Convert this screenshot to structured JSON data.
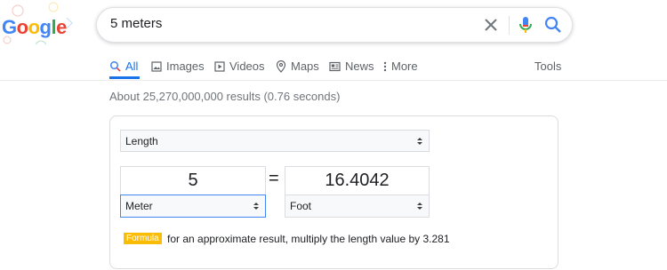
{
  "logo": {
    "letters": [
      "G",
      "o",
      "o",
      "g",
      "l",
      "e"
    ],
    "colors": [
      "#4285f4",
      "#ea4335",
      "#fbbc05",
      "#4285f4",
      "#34a853",
      "#ea4335"
    ]
  },
  "search": {
    "query": "5 meters",
    "placeholder": ""
  },
  "nav": {
    "items": [
      {
        "label": "All",
        "icon": "search-icon",
        "active": true
      },
      {
        "label": "Images",
        "icon": "image-icon"
      },
      {
        "label": "Videos",
        "icon": "video-icon"
      },
      {
        "label": "Maps",
        "icon": "map-pin-icon"
      },
      {
        "label": "News",
        "icon": "news-icon"
      },
      {
        "label": "More",
        "icon": "more-vert-icon"
      }
    ],
    "tools": "Tools"
  },
  "results_stats": "About 25,270,000,000 results (0.76 seconds)",
  "converter": {
    "category": "Length",
    "from_value": "5",
    "equals": "=",
    "to_value": "16.4042",
    "from_unit": "Meter",
    "to_unit": "Foot",
    "formula_badge": "Formula",
    "formula_text": "for an approximate result, multiply the length value by 3.281"
  },
  "colors": {
    "accent": "#1a73e8",
    "formula": "#fbbc05"
  }
}
